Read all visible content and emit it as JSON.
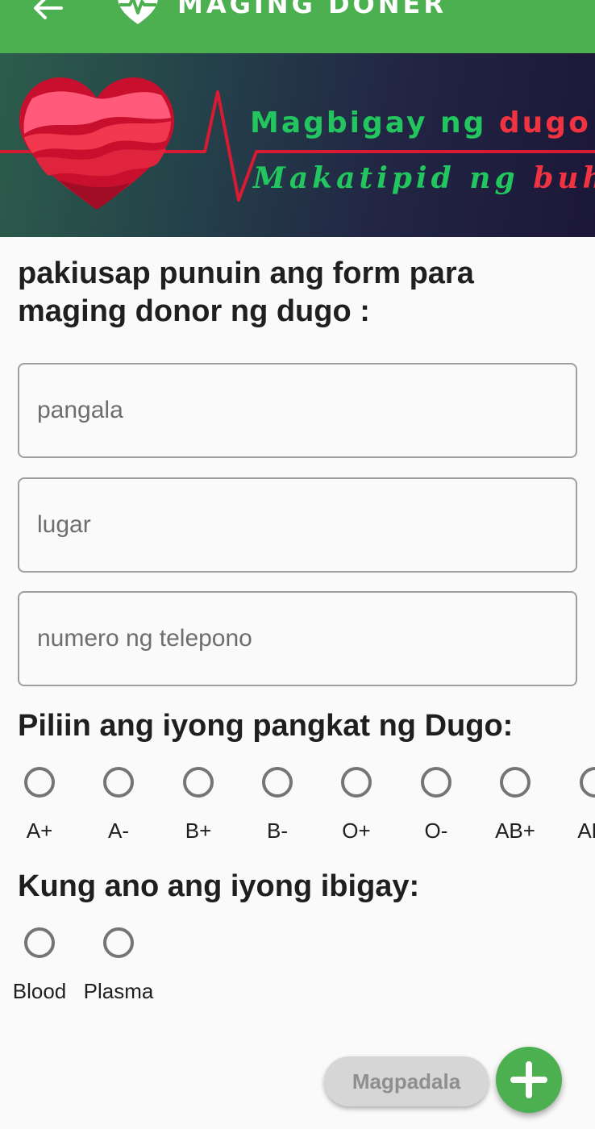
{
  "app_bar": {
    "title": "MAGING DONER",
    "back_icon": "arrow-left-icon",
    "logo_icon": "heart-pulse-icon",
    "background_color": "#4caf50"
  },
  "banner": {
    "line1_green": "Magbigay ng",
    "line1_red": "dugo",
    "line2_green": "Makatipid ng",
    "line2_red": "buhay",
    "heart_icon": "heart-icon"
  },
  "form": {
    "title": "pakiusap punuin ang form para maging donor ng dugo :",
    "fields": {
      "name": {
        "placeholder": "pangala",
        "value": ""
      },
      "place": {
        "placeholder": "lugar",
        "value": ""
      },
      "phone": {
        "placeholder": "numero ng telepono",
        "value": ""
      }
    },
    "blood_group": {
      "heading": "Piliin ang iyong pangkat ng Dugo:",
      "options": [
        "A+",
        "A-",
        "B+",
        "B-",
        "O+",
        "O-",
        "AB+",
        "AB-"
      ],
      "selected": null
    },
    "donation_type": {
      "heading": "Kung ano ang iyong ibigay:",
      "options": [
        "Blood",
        "Plasma"
      ],
      "selected": null
    },
    "submit_label": "Magpadala",
    "fab_icon": "plus-icon"
  }
}
